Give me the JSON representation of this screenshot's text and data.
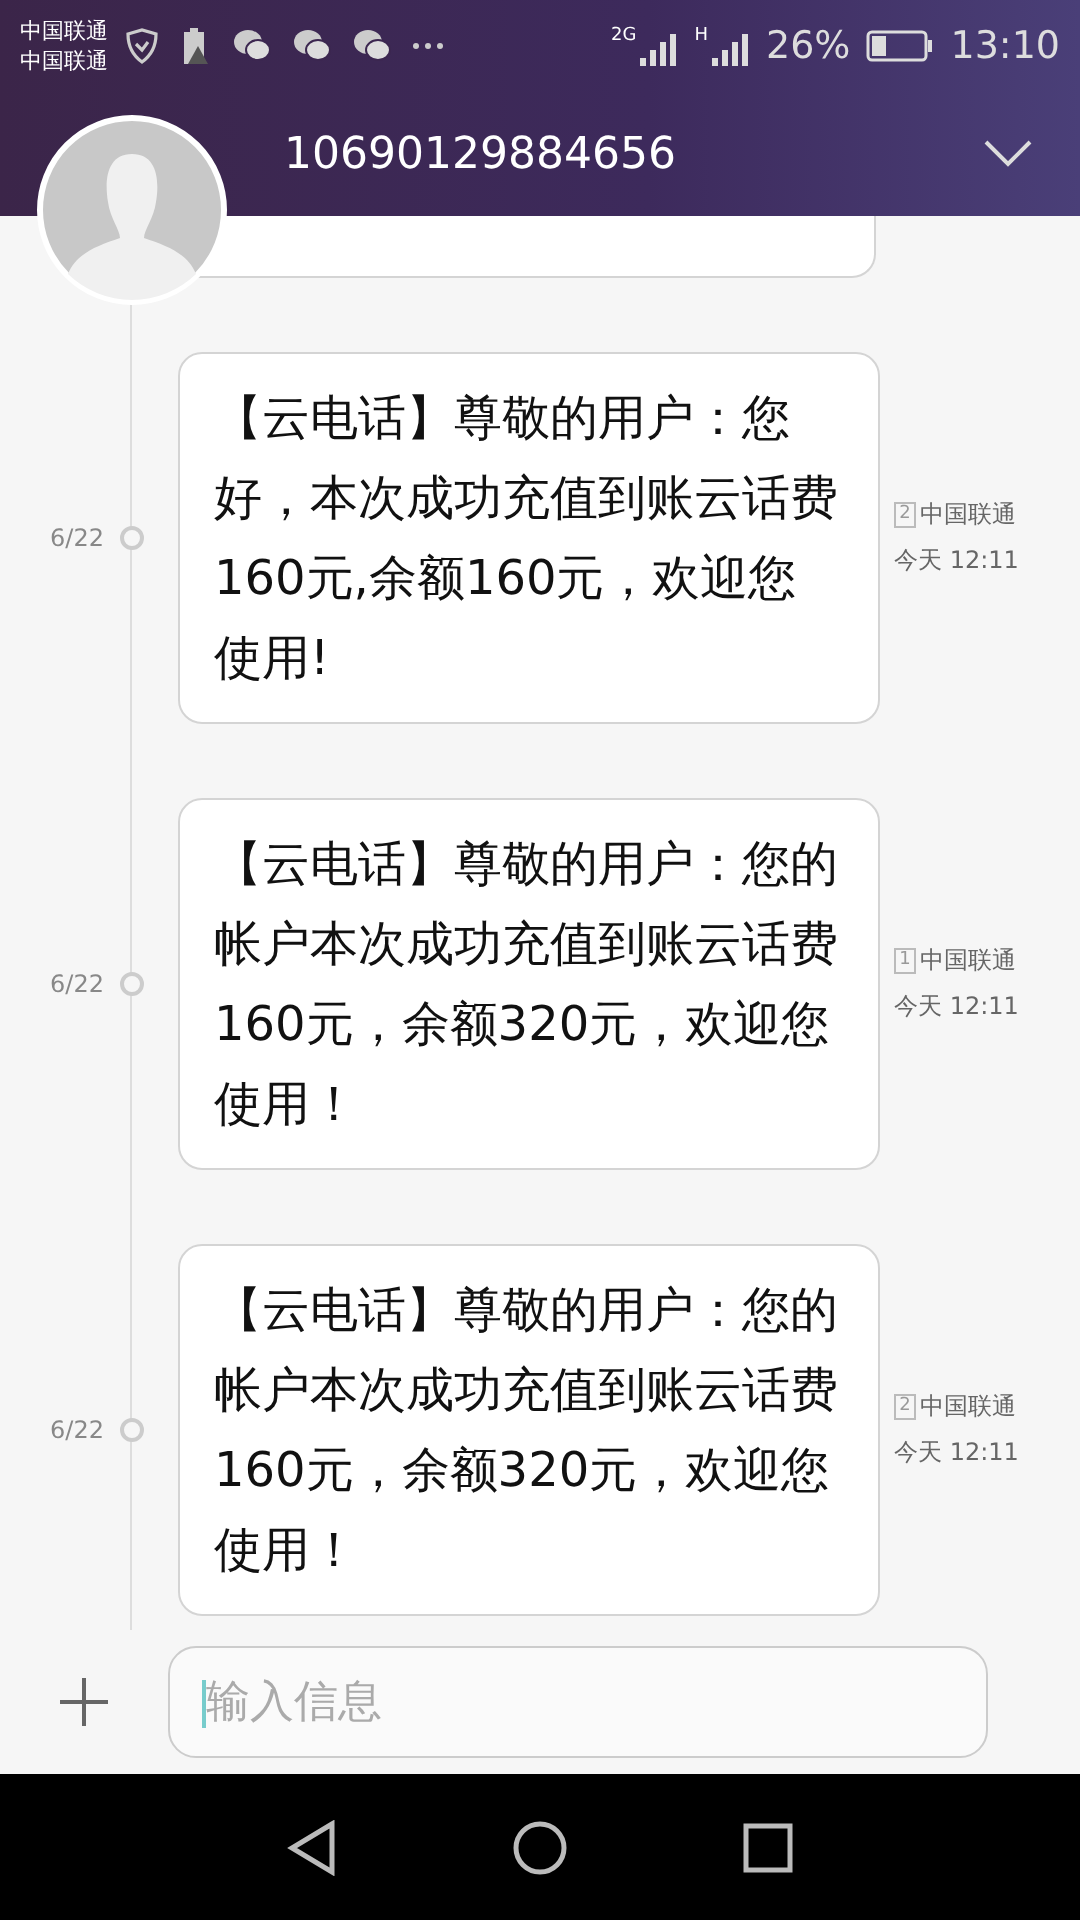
{
  "status_bar": {
    "carriers": [
      "中国联通",
      "中国联通"
    ],
    "network_labels": [
      "2G",
      "H"
    ],
    "battery": "26%",
    "time": "13:10"
  },
  "header": {
    "title": "10690129884656"
  },
  "messages": [
    {
      "kind": "partial"
    },
    {
      "kind": "full",
      "date": "6/22",
      "text": "【云电话】尊敬的用户：您好，本次成功充值到账云话费160元,余额160元，欢迎您使用!",
      "sim": "2",
      "carrier": "中国联通",
      "time": "今天 12:11"
    },
    {
      "kind": "full",
      "date": "6/22",
      "text": "【云电话】尊敬的用户：您的帐户本次成功充值到账云话费160元，余额320元，欢迎您使用！",
      "sim": "1",
      "carrier": "中国联通",
      "time": "今天 12:11"
    },
    {
      "kind": "full",
      "date": "6/22",
      "text": "【云电话】尊敬的用户：您的帐户本次成功充值到账云话费160元，余额320元，欢迎您使用！",
      "sim": "2",
      "carrier": "中国联通",
      "time": "今天 12:11"
    }
  ],
  "composer": {
    "placeholder": "输入信息"
  }
}
